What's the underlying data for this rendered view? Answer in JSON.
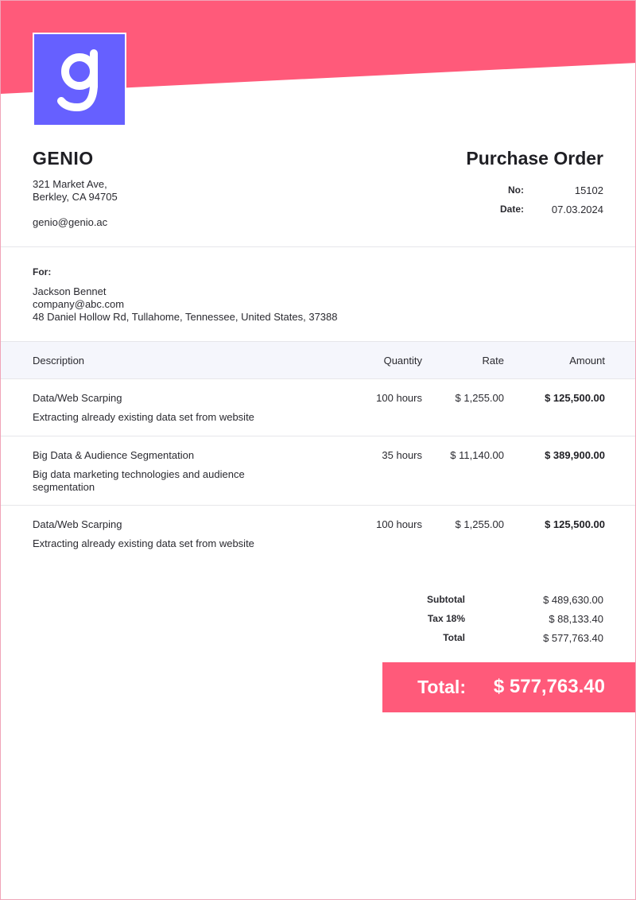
{
  "colors": {
    "banner": "#ff5a7a",
    "logo_bg": "#6660ff",
    "table_header_bg": "#f5f6fc",
    "total_bar": "#ff5a7a"
  },
  "logo": {
    "glyph": "g",
    "icon": "genio-logo-icon"
  },
  "company": {
    "name": "GENIO",
    "address_line1": "321 Market Ave,",
    "address_line2": "Berkley, CA 94705",
    "email": "genio@genio.ac"
  },
  "document": {
    "title": "Purchase Order",
    "no_label": "No:",
    "no_value": "15102",
    "date_label": "Date:",
    "date_value": "07.03.2024"
  },
  "client": {
    "label": "For:",
    "name": "Jackson Bennet",
    "email": "company@abc.com",
    "address": "48 Daniel Hollow Rd, Tullahome, Tennessee, United States, 37388"
  },
  "table": {
    "headers": {
      "description": "Description",
      "quantity": "Quantity",
      "rate": "Rate",
      "amount": "Amount"
    },
    "items": [
      {
        "title": "Data/Web Scarping",
        "description": "Extracting already existing data set from website",
        "quantity": "100 hours",
        "rate": "$ 1,255.00",
        "amount": "$ 125,500.00"
      },
      {
        "title": "Big Data & Audience Segmentation",
        "description": "Big data marketing technologies and audience segmentation",
        "quantity": "35 hours",
        "rate": "$ 11,140.00",
        "amount": "$ 389,900.00"
      },
      {
        "title": "Data/Web Scarping",
        "description": "Extracting already existing data set from website",
        "quantity": "100 hours",
        "rate": "$ 1,255.00",
        "amount": "$ 125,500.00"
      }
    ]
  },
  "summary": {
    "subtotal_label": "Subtotal",
    "subtotal_value": "$ 489,630.00",
    "tax_label": "Tax 18%",
    "tax_value": "$ 88,133.40",
    "total_label": "Total",
    "total_value": "$ 577,763.40"
  },
  "grand_total": {
    "label": "Total:",
    "value": "$ 577,763.40"
  }
}
